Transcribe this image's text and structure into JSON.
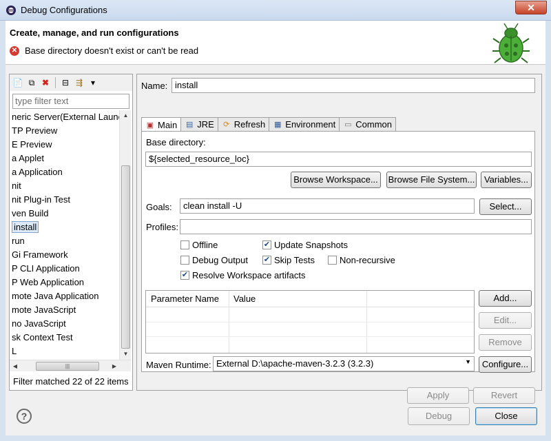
{
  "window": {
    "title": "Debug Configurations",
    "close_glyph": "✕"
  },
  "header": {
    "title": "Create, manage, and run configurations",
    "error": "Base directory doesn't exist or can't be read"
  },
  "left": {
    "filter_placeholder": "type filter text",
    "items": [
      "neric Server(External Launc",
      "TP Preview",
      "E Preview",
      "a Applet",
      "a Application",
      "nit",
      "nit Plug-in Test",
      "ven Build",
      "install",
      "run",
      "Gi Framework",
      "P CLI Application",
      "P Web Application",
      "mote Java Application",
      "mote JavaScript",
      "no JavaScript",
      "sk Context Test",
      "L"
    ],
    "selected_index": 8,
    "filter_status": "Filter matched 22 of 22 items"
  },
  "right": {
    "name_label": "Name:",
    "name_value": "install",
    "tabs": [
      {
        "label": "Main",
        "icon": "main-tab-icon"
      },
      {
        "label": "JRE",
        "icon": "jre-tab-icon"
      },
      {
        "label": "Refresh",
        "icon": "refresh-tab-icon"
      },
      {
        "label": "Environment",
        "icon": "environment-tab-icon"
      },
      {
        "label": "Common",
        "icon": "common-tab-icon"
      }
    ],
    "active_tab": "Main",
    "base_dir_label": "Base directory:",
    "base_dir_value": "${selected_resource_loc}",
    "browse_workspace": "Browse Workspace...",
    "browse_fs": "Browse File System...",
    "variables": "Variables...",
    "goals_label": "Goals:",
    "goals_value": "clean install -U",
    "select": "Select...",
    "profiles_label": "Profiles:",
    "profiles_value": "",
    "checks": {
      "offline": {
        "label": "Offline",
        "checked": false
      },
      "update_snapshots": {
        "label": "Update Snapshots",
        "checked": true
      },
      "debug_output": {
        "label": "Debug Output",
        "checked": false
      },
      "skip_tests": {
        "label": "Skip Tests",
        "checked": true
      },
      "non_recursive": {
        "label": "Non-recursive",
        "checked": false
      },
      "resolve_ws": {
        "label": "Resolve Workspace artifacts",
        "checked": true
      }
    },
    "table": {
      "col1": "Parameter Name",
      "col2": "Value"
    },
    "add": "Add...",
    "edit": "Edit...",
    "remove": "Remove",
    "runtime_label": "Maven Runtime:",
    "runtime_value": "External D:\\apache-maven-3.2.3 (3.2.3)",
    "configure": "Configure...",
    "apply": "Apply",
    "revert": "Revert"
  },
  "footer": {
    "debug": "Debug",
    "close": "Close"
  }
}
